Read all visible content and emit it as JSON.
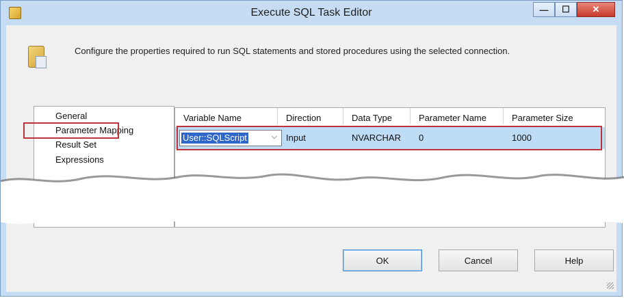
{
  "window": {
    "title": "Execute SQL Task Editor"
  },
  "description": "Configure the properties required to run SQL statements and stored procedures using the selected connection.",
  "nav": {
    "items": [
      {
        "label": "General"
      },
      {
        "label": "Parameter Mapping",
        "selected": true
      },
      {
        "label": "Result Set"
      },
      {
        "label": "Expressions"
      }
    ]
  },
  "grid": {
    "columns": [
      "Variable Name",
      "Direction",
      "Data Type",
      "Parameter Name",
      "Parameter Size"
    ],
    "rows": [
      {
        "variable_name": "User::SQLScript",
        "direction": "Input",
        "data_type": "NVARCHAR",
        "parameter_name": "0",
        "parameter_size": "1000"
      }
    ]
  },
  "buttons": {
    "ok": "OK",
    "cancel": "Cancel",
    "help": "Help"
  },
  "colors": {
    "titlebar": "#c6dcf3",
    "selection_row": "#bfdcf6",
    "highlight_border": "#c0323a",
    "select_text": "#2f67c8"
  },
  "icons": [
    "app-icon",
    "sql-task-icon",
    "minimize-icon",
    "maximize-icon",
    "close-icon",
    "dropdown-arrow-icon",
    "resize-grip-icon"
  ]
}
